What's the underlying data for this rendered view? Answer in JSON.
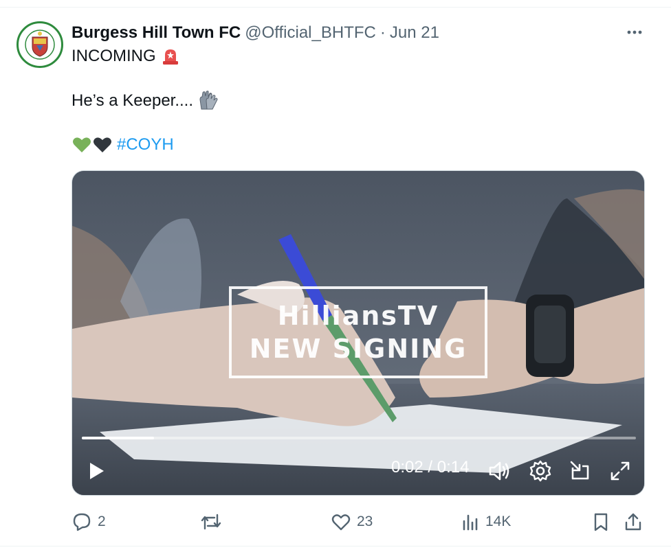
{
  "post": {
    "author_name": "Burgess Hill Town FC",
    "handle": "@Official_BHTFC",
    "separator": "·",
    "date": "Jun 21",
    "line1": "INCOMING",
    "line2": "He’s a Keeper....",
    "hashtag": "#COYH"
  },
  "video": {
    "overlay_title": "HilliansTV",
    "overlay_subtitle": "NEW SIGNING",
    "time_display": "0:02 / 0:14",
    "progress_fraction": 0.13
  },
  "actions": {
    "replies": "2",
    "retweets": "",
    "likes": "23",
    "views": "14K"
  },
  "icons": {
    "more": "more-horizontal-icon",
    "siren": "police-light-icon",
    "gloves": "goalkeeper-gloves-icon",
    "green_heart": "green-heart-icon",
    "black_heart": "black-heart-icon",
    "play": "play-icon",
    "volume": "volume-icon",
    "settings": "settings-icon",
    "pip": "picture-in-picture-icon",
    "fullscreen": "fullscreen-icon",
    "reply": "reply-icon",
    "retweet": "retweet-icon",
    "like": "heart-icon",
    "views": "views-chart-icon",
    "bookmark": "bookmark-icon",
    "share": "share-icon"
  },
  "colors": {
    "accent": "#1d9bf0",
    "text": "#0f1419",
    "muted": "#536471",
    "club_green": "#2e8b3d"
  }
}
